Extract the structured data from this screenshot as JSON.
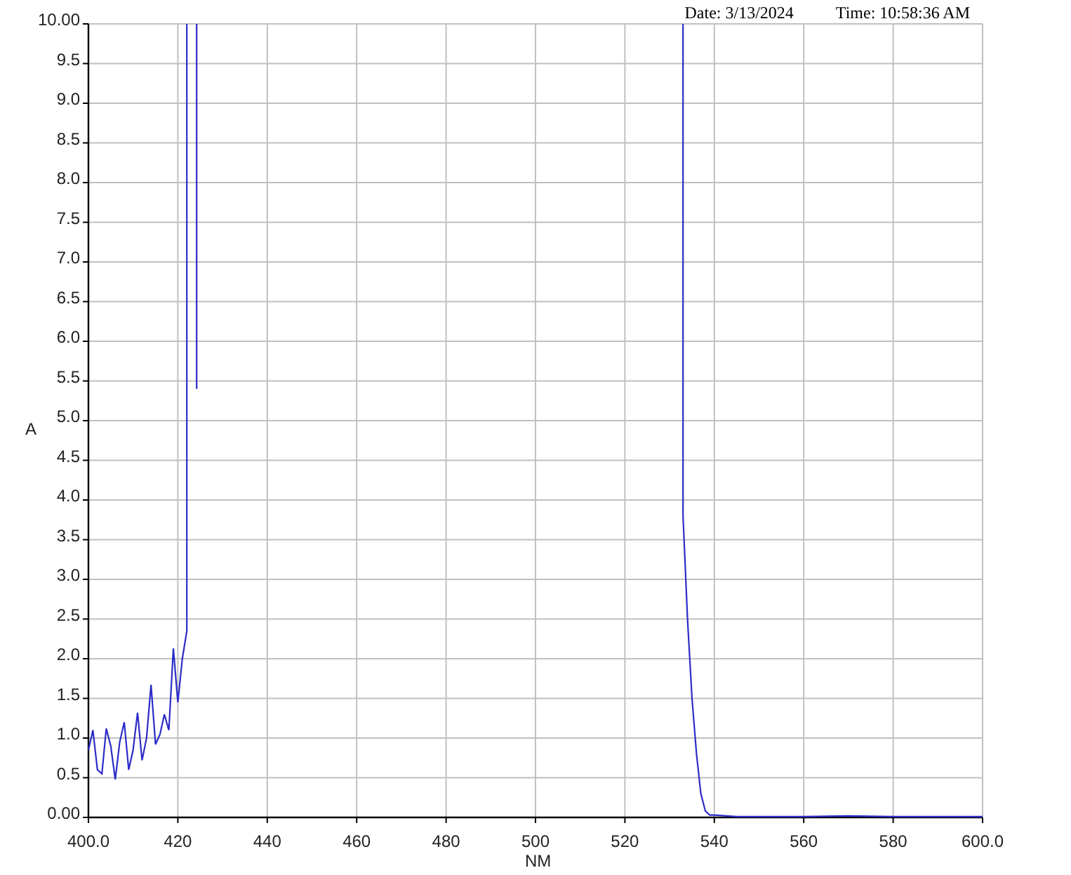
{
  "header": {
    "date": "Date: 3/13/2024",
    "time": "Time: 10:58:36 AM"
  },
  "chart": {
    "chart_data": {
      "type": "line",
      "xlabel": "NM",
      "ylabel": "A",
      "xlim": [
        400,
        600
      ],
      "ylim": [
        0,
        10
      ],
      "xticks": [
        {
          "value": 400,
          "label": "400.0"
        },
        420,
        440,
        460,
        480,
        500,
        520,
        540,
        560,
        580,
        {
          "value": 600,
          "label": "600.0"
        }
      ],
      "yticks": [
        {
          "value": 0,
          "label": "0.00"
        },
        {
          "value": 0.5,
          "label": "0.5"
        },
        {
          "value": 1,
          "label": "1.0"
        },
        {
          "value": 1.5,
          "label": "1.5"
        },
        {
          "value": 2,
          "label": "2.0"
        },
        {
          "value": 2.5,
          "label": "2.5"
        },
        {
          "value": 3,
          "label": "3.0"
        },
        {
          "value": 3.5,
          "label": "3.5"
        },
        {
          "value": 4,
          "label": "4.0"
        },
        {
          "value": 4.5,
          "label": "4.5"
        },
        {
          "value": 5,
          "label": "5.0"
        },
        {
          "value": 5.5,
          "label": "5.5"
        },
        {
          "value": 6,
          "label": "6.0"
        },
        {
          "value": 6.5,
          "label": "6.5"
        },
        {
          "value": 7,
          "label": "7.0"
        },
        {
          "value": 7.5,
          "label": "7.5"
        },
        {
          "value": 8,
          "label": "8.0"
        },
        {
          "value": 8.5,
          "label": "8.5"
        },
        {
          "value": 9,
          "label": "9.0"
        },
        {
          "value": 9.5,
          "label": "9.5"
        },
        {
          "value": 10,
          "label": "10.00"
        }
      ],
      "grid": true,
      "x": [
        400,
        401,
        402,
        403,
        404,
        405,
        406,
        407,
        408,
        409,
        410,
        411,
        412,
        413,
        414,
        415,
        416,
        417,
        418,
        419,
        420,
        421,
        422,
        422,
        null,
        424.2,
        424.2,
        null,
        533,
        533,
        534,
        535,
        536,
        537,
        538,
        539,
        540,
        545,
        560,
        570,
        580,
        600
      ],
      "series": [
        {
          "color": "#2c2cc8",
          "values": [
            0.85,
            1.1,
            0.6,
            0.55,
            1.12,
            0.9,
            0.48,
            0.95,
            1.2,
            0.6,
            0.85,
            1.32,
            0.72,
            1.0,
            1.67,
            0.92,
            1.05,
            1.3,
            1.1,
            2.13,
            1.45,
            2.0,
            2.35,
            10,
            null,
            10,
            5.4,
            null,
            10,
            3.8,
            2.5,
            1.5,
            0.8,
            0.3,
            0.08,
            0.03,
            0.03,
            0.01,
            0.01,
            0.02,
            0.01,
            0.01
          ]
        }
      ]
    }
  }
}
